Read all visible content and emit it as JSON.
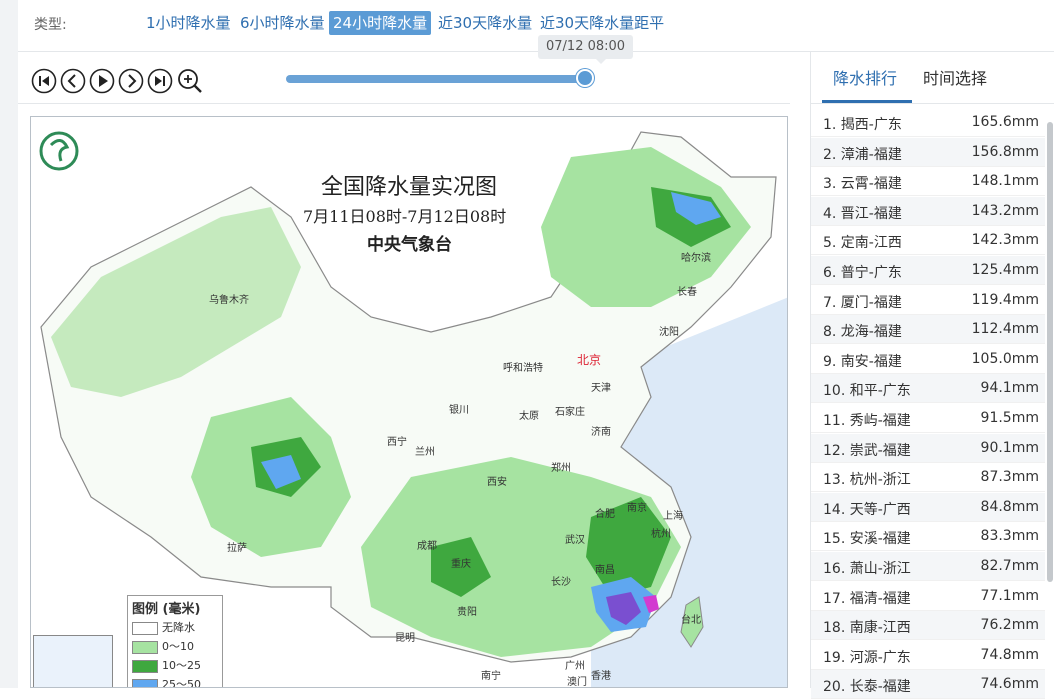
{
  "header": {
    "type_label": "类型:",
    "types": [
      {
        "label": "1小时降水量",
        "active": false
      },
      {
        "label": "6小时降水量",
        "active": false
      },
      {
        "label": "24小时降水量",
        "active": true
      },
      {
        "label": "近30天降水量",
        "active": false
      },
      {
        "label": "近30天降水量距平",
        "active": false
      }
    ]
  },
  "timeline": {
    "current_time": "07/12 08:00",
    "progress": 1.0
  },
  "map": {
    "title": "全国降水量实况图",
    "subtitle": "7月11日08时-7月12日08时",
    "organization": "中央气象台",
    "capital": "北京",
    "cities": [
      "乌鲁木齐",
      "哈尔滨",
      "长春",
      "沈阳",
      "呼和浩特",
      "天津",
      "银川",
      "太原",
      "石家庄",
      "西宁",
      "兰州",
      "济南",
      "郑州",
      "西安",
      "拉萨",
      "成都",
      "重庆",
      "合肥",
      "南京",
      "上海",
      "杭州",
      "武汉",
      "长沙",
      "南昌",
      "贵阳",
      "昆明",
      "南宁",
      "广州",
      "澳门",
      "香港",
      "台北"
    ],
    "legend": {
      "title": "图例 (毫米)",
      "items": [
        {
          "label": "无降水",
          "color": "#ffffff"
        },
        {
          "label": "0～10",
          "color": "#a6e3a1"
        },
        {
          "label": "10～25",
          "color": "#3fa83f"
        },
        {
          "label": "25～50",
          "color": "#5fa7f0"
        }
      ]
    }
  },
  "panel": {
    "tabs": [
      {
        "label": "降水排行",
        "active": true
      },
      {
        "label": "时间选择",
        "active": false
      }
    ],
    "ranking": [
      {
        "name": "1. 揭西-广东",
        "value": "165.6mm"
      },
      {
        "name": "2. 漳浦-福建",
        "value": "156.8mm"
      },
      {
        "name": "3. 云霄-福建",
        "value": "148.1mm"
      },
      {
        "name": "4. 晋江-福建",
        "value": "143.2mm"
      },
      {
        "name": "5. 定南-江西",
        "value": "142.3mm"
      },
      {
        "name": "6. 普宁-广东",
        "value": "125.4mm"
      },
      {
        "name": "7. 厦门-福建",
        "value": "119.4mm"
      },
      {
        "name": "8. 龙海-福建",
        "value": "112.4mm"
      },
      {
        "name": "9. 南安-福建",
        "value": "105.0mm"
      },
      {
        "name": "10. 和平-广东",
        "value": "94.1mm"
      },
      {
        "name": "11. 秀屿-福建",
        "value": "91.5mm"
      },
      {
        "name": "12. 崇武-福建",
        "value": "90.1mm"
      },
      {
        "name": "13. 杭州-浙江",
        "value": "87.3mm"
      },
      {
        "name": "14. 天等-广西",
        "value": "84.8mm"
      },
      {
        "name": "15. 安溪-福建",
        "value": "83.3mm"
      },
      {
        "name": "16. 萧山-浙江",
        "value": "82.7mm"
      },
      {
        "name": "17. 福清-福建",
        "value": "77.1mm"
      },
      {
        "name": "18. 南康-江西",
        "value": "76.2mm"
      },
      {
        "name": "19. 河源-广东",
        "value": "74.8mm"
      },
      {
        "name": "20. 长泰-福建",
        "value": "74.6mm"
      }
    ]
  },
  "icons": [
    "skip-start-icon",
    "prev-icon",
    "play-icon",
    "next-icon",
    "skip-end-icon",
    "zoom-in-icon",
    "cma-logo-icon"
  ]
}
